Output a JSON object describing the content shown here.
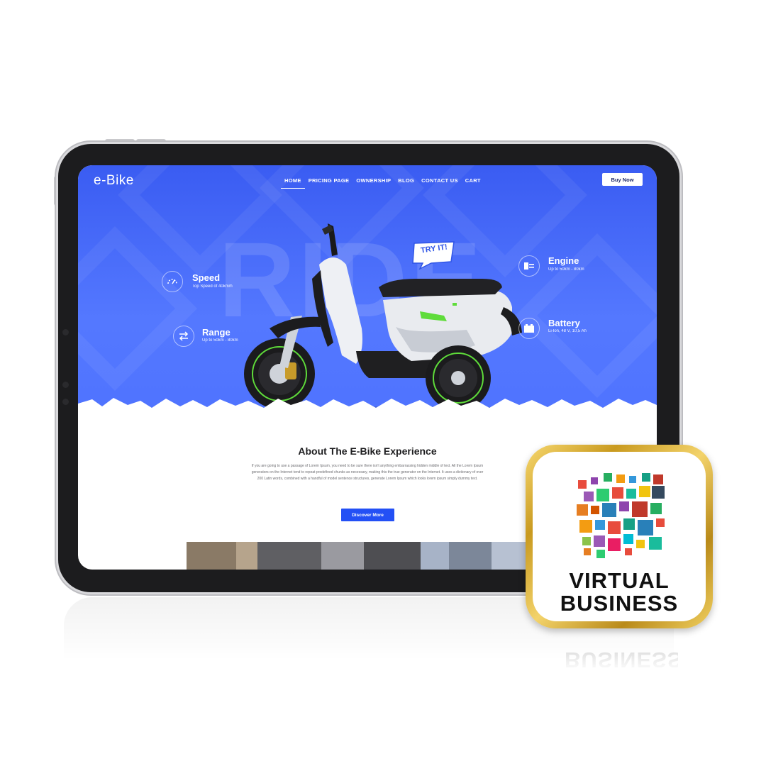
{
  "site": {
    "logo": "e-Bike",
    "nav": [
      "HOME",
      "PRICING PAGE",
      "OWNERSHIP",
      "BLOG",
      "CONTACT US",
      "CART"
    ],
    "active_nav": "HOME",
    "buy_button": "Buy Now"
  },
  "hero": {
    "background_word": "RIDE",
    "sticker": "TRY IT!",
    "features": {
      "speed": {
        "title": "Speed",
        "subtitle": "Top Speed of 40km/h",
        "icon": "speedometer-icon"
      },
      "range": {
        "title": "Range",
        "subtitle": "Up to 50km - 80km",
        "icon": "swap-arrows-icon"
      },
      "engine": {
        "title": "Engine",
        "subtitle": "Up to 50km - 80km",
        "icon": "engine-icon"
      },
      "battery": {
        "title": "Battery",
        "subtitle": "Li-Ion, 48 V, 10,5 Ah",
        "icon": "battery-icon"
      }
    },
    "colors": {
      "hero_blue": "#4a6cf7",
      "accent_green": "#5fdc3a"
    }
  },
  "about": {
    "title": "About The E-Bike Experience",
    "body": "If you are going to use a passage of Lorem Ipsum, you need to be sure there isn't anything embarrassing hidden middle of text. All the Lorem Ipsum generators on the Internet tend to repeat predefined chunks as necessary, making this the true generator on the Internet. It uses a dictionary of over 200 Latin words, combined with a handful of model sentence structures, generate Lorem Ipsum which looks lorem ipsum simply dummy text.",
    "button": "Discover More",
    "button_color": "#2350f5"
  },
  "badge": {
    "line1": "VIRTUAL",
    "line2": "BUSINESS",
    "frame_color": "#d4a52a"
  }
}
